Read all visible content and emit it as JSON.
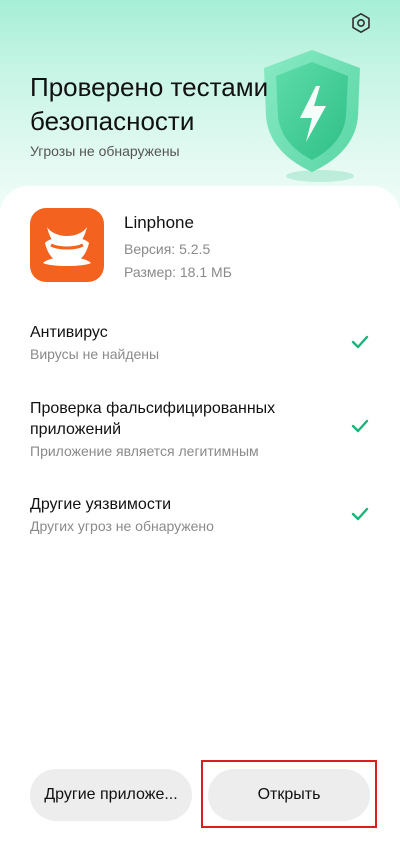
{
  "header": {
    "title": "Проверено тестами безопасности",
    "subtitle": "Угрозы не обнаружены",
    "settings_icon": "settings-gear-icon",
    "shield_icon": "shield-lightning-icon"
  },
  "app": {
    "name": "Linphone",
    "version": "Версия: 5.2.5",
    "size": "Размер: 18.1 МБ",
    "icon": "linphone-app-icon",
    "icon_color": "#f3631f"
  },
  "checks": [
    {
      "title": "Антивирус",
      "description": "Вирусы не найдены",
      "status_icon": "check-icon"
    },
    {
      "title": "Проверка фальсифицированных приложений",
      "description": "Приложение является легитимным",
      "status_icon": "check-icon"
    },
    {
      "title": "Другие уязвимости",
      "description": "Других угроз не обнаружено",
      "status_icon": "check-icon"
    }
  ],
  "buttons": {
    "other_apps": "Другие приложе...",
    "open": "Открыть"
  },
  "colors": {
    "accent_green": "#1bb37a",
    "highlight_red": "#d81e1e"
  }
}
